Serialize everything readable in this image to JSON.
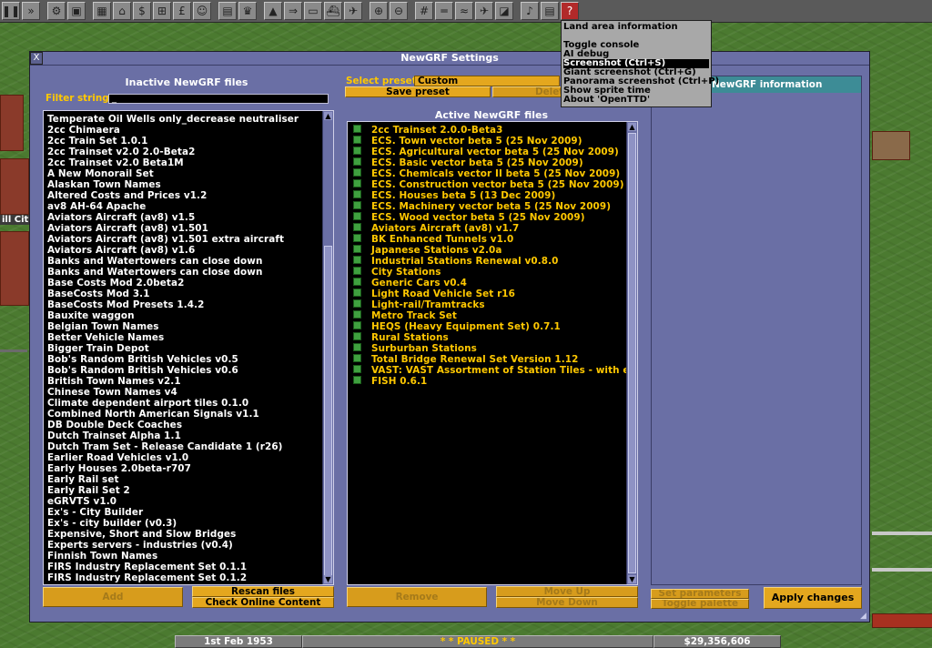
{
  "toolbar": {
    "buttons": [
      "pause-icon",
      "fast-forward-icon",
      "settings-gear-icon",
      "save-disk-icon",
      "map-icon",
      "town-directory-icon",
      "subsidies-icon",
      "station-list-icon",
      "finances-icon",
      "company-face-icon",
      "graphs-icon",
      "league-trophy-icon",
      "industry-icon",
      "train-list-icon",
      "road-vehicle-list-icon",
      "ship-list-icon",
      "aircraft-list-icon",
      "zoom-in-icon",
      "zoom-out-icon",
      "build-rail-icon",
      "build-road-icon",
      "build-water-icon",
      "build-air-icon",
      "landscaping-icon",
      "music-icon",
      "news-icon",
      "help-icon"
    ]
  },
  "help_menu": {
    "items": [
      "Land area information",
      "",
      "Toggle console",
      "AI debug",
      "Screenshot (Ctrl+S)",
      "Giant screenshot (Ctrl+G)",
      "Panorama screenshot (Ctrl+P)",
      "Show sprite time",
      "About 'OpenTTD'"
    ],
    "selected_index": 4
  },
  "window": {
    "title": "NewGRF Settings",
    "close_label": "X",
    "inactive": {
      "title": "Inactive NewGRF files",
      "filter_label": "Filter string:",
      "filter_value": "_",
      "items": [
        "Temperate Oil Wells only_decrease neutraliser",
        "2cc Chimaera",
        "2cc Train Set 1.0.1",
        "2cc Trainset v2.0 2.0-Beta2",
        "2cc Trainset v2.0 Beta1M",
        "A New Monorail Set",
        "Alaskan Town Names",
        "Altered Costs and Prices v1.2",
        "av8 AH-64 Apache",
        "Aviators Aircraft (av8) v1.5",
        "Aviators Aircraft (av8) v1.501",
        "Aviators Aircraft (av8) v1.501 extra aircraft",
        "Aviators Aircraft (av8) v1.6",
        "Banks and Watertowers can close down",
        "Banks and Watertowers can close down",
        "Base Costs Mod 2.0beta2",
        "BaseCosts Mod 3.1",
        "BaseCosts Mod Presets 1.4.2",
        "Bauxite waggon",
        "Belgian Town Names",
        "Better Vehicle Names",
        "Bigger Train Depot",
        "Bob's Random British Vehicles v0.5",
        "Bob's Random British Vehicles v0.6",
        "British Town Names v2.1",
        "Chinese Town Names v4",
        "Climate dependent airport tiles 0.1.0",
        "Combined North American Signals v1.1",
        "DB Double Deck Coaches",
        "Dutch Trainset Alpha 1.1",
        "Dutch Tram Set - Release Candidate 1 (r26)",
        "Earlier Road Vehicles v1.0",
        "Early Houses 2.0beta-r707",
        "Early Rail set",
        "Early Rail Set 2",
        "eGRVTS v1.0",
        "Ex's - City Builder",
        "Ex's - city builder (v0.3)",
        "Expensive, Short and Slow Bridges",
        "Experts servers - industries (v0.4)",
        "Finnish Town Names",
        "FIRS Industry Replacement Set 0.1.1",
        "FIRS Industry Replacement Set 0.1.2"
      ],
      "add_label": "Add",
      "rescan_label": "Rescan files",
      "check_online_label": "Check Online Content"
    },
    "preset": {
      "label": "Select preset:",
      "value": "Custom",
      "save_label": "Save preset",
      "delete_label": "Delete"
    },
    "active": {
      "title": "Active NewGRF files",
      "items": [
        "2cc Trainset 2.0.0-Beta3",
        "ECS. Town vector beta 5 (25 Nov 2009)",
        "ECS. Agricultural vector beta 5 (25 Nov 2009)",
        "ECS. Basic vector beta 5 (25 Nov 2009)",
        "ECS. Chemicals vector II beta 5 (25 Nov 2009)",
        "ECS. Construction vector beta 5 (25 Nov 2009)",
        "ECS. Houses beta 5 (13 Dec 2009)",
        "ECS. Machinery vector beta 5 (25 Nov 2009)",
        "ECS. Wood vector beta 5 (25 Nov 2009)",
        "Aviators Aircraft (av8) v1.7",
        "BK Enhanced Tunnels v1.0",
        "Japanese Stations v2.0a",
        "Industrial Stations Renewal v0.8.0",
        "City Stations",
        "Generic Cars v0.4",
        "Light Road Vehicle Set r16",
        "Light-rail/Tramtracks",
        "Metro Track Set",
        "HEQS (Heavy Equipment Set) 0.7.1",
        "Rural Stations",
        "Surburban Stations",
        "Total Bridge Renewal Set Version 1.12",
        "VAST: VAST Assortment of Station Tiles - with e...",
        "FISH 0.6.1"
      ],
      "remove_label": "Remove",
      "move_up_label": "Move Up",
      "move_down_label": "Move Down"
    },
    "info": {
      "title": "ed NewGRF information",
      "set_params_label": "Set parameters",
      "toggle_palette_label": "Toggle palette",
      "apply_label": "Apply changes"
    }
  },
  "statusbar": {
    "date": "1st Feb 1953",
    "state": "* * PAUSED * *",
    "money": "$29,356,606"
  },
  "map": {
    "city_label": "ill Cit"
  }
}
